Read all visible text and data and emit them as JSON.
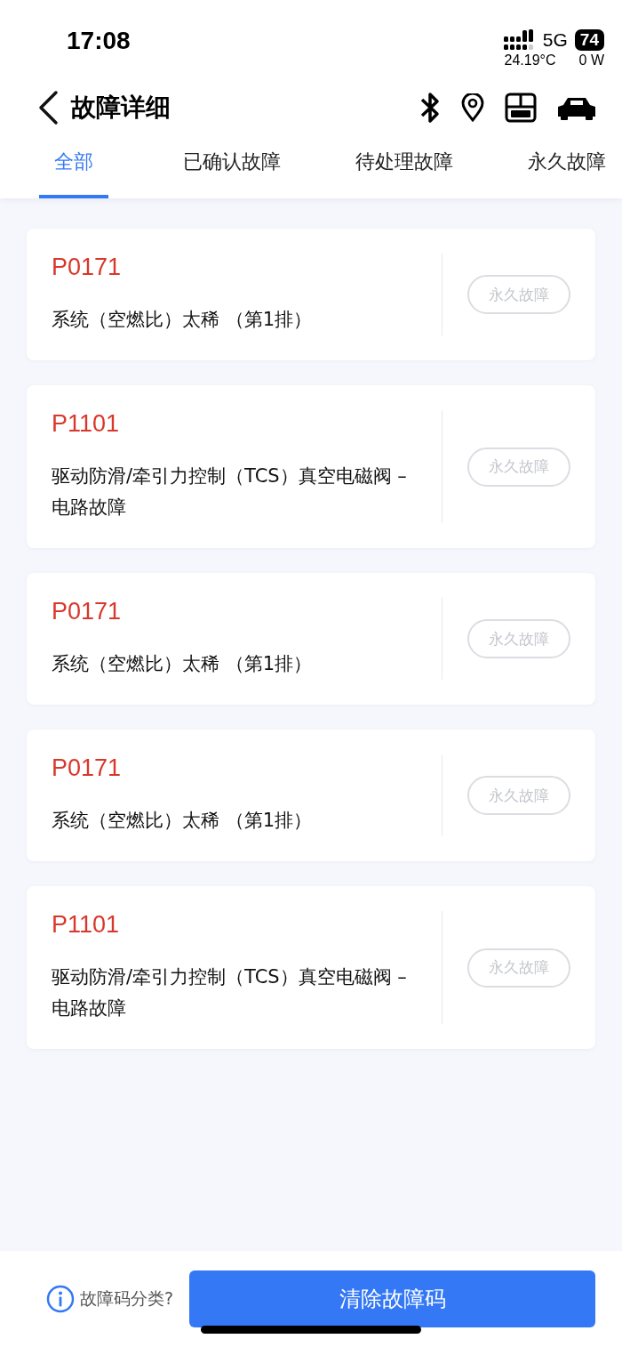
{
  "status_bar": {
    "time": "17:08",
    "network": "5G",
    "battery": "74",
    "temperature": "24.19°C",
    "power": "0 W"
  },
  "header": {
    "title": "故障详细"
  },
  "tabs": [
    {
      "label": "全部",
      "selected": true
    },
    {
      "label": "已确认故障",
      "selected": false
    },
    {
      "label": "待处理故障",
      "selected": false
    },
    {
      "label": "永久故障",
      "selected": false
    }
  ],
  "faults": [
    {
      "code": "P0171",
      "description": "系统（空燃比）太稀 （第1排）",
      "tag": "永久故障",
      "disabled": true
    },
    {
      "code": "P1101",
      "description": "驱动防滑/牵引力控制（TCS）真空电磁阀 – 电路故障",
      "tag": "永久故障",
      "disabled": true
    },
    {
      "code": "P0171",
      "description": "系统（空燃比）太稀 （第1排）",
      "tag": "永久故障",
      "disabled": true
    },
    {
      "code": "P0171",
      "description": "系统（空燃比）太稀 （第1排）",
      "tag": "永久故障",
      "disabled": true
    },
    {
      "code": "P1101",
      "description": "驱动防滑/牵引力控制（TCS）真空电磁阀 – 电路故障",
      "tag": "永久故障",
      "disabled": true
    }
  ],
  "footer": {
    "help_link": "故障码分类?",
    "clear_button": "清除故障码"
  }
}
